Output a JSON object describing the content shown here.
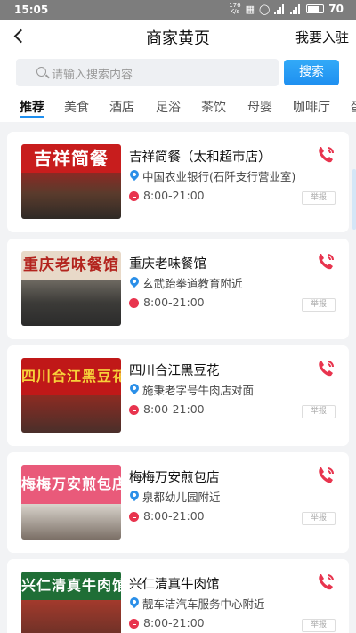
{
  "status_bar": {
    "time": "15:05",
    "network": "176\nK/s",
    "battery": "70"
  },
  "nav": {
    "title": "商家黄页",
    "right_action": "我要入驻"
  },
  "search": {
    "placeholder": "请输入搜索内容",
    "button": "搜索"
  },
  "tabs": [
    "推荐",
    "美食",
    "酒店",
    "足浴",
    "茶饮",
    "母婴",
    "咖啡厅",
    "蛋"
  ],
  "active_tab": "推荐",
  "accent_color": "#1e8ff0",
  "report_label": "举报",
  "merchants": [
    {
      "name": "吉祥简餐（太和超市店）",
      "address": "中国农业银行(石阡支行营业室)",
      "hours": "8:00-21:00",
      "sign_text": "吉祥简餐",
      "sign_bg": "#c81d1d",
      "sign_color": "#ffffff"
    },
    {
      "name": "重庆老味餐馆",
      "address": "玄武跆拳道教育附近",
      "hours": "8:00-21:00",
      "sign_text": "重庆老味餐馆",
      "sign_bg": "#e8d9c8",
      "sign_color": "#b3241e"
    },
    {
      "name": "四川合江黑豆花",
      "address": "施秉老字号牛肉店对面",
      "hours": "8:00-21:00",
      "sign_text": "四川合江黑豆花",
      "sign_bg": "#c01818",
      "sign_color": "#f7d13a"
    },
    {
      "name": "梅梅万安煎包店",
      "address": "泉都幼儿园附近",
      "hours": "8:00-21:00",
      "sign_text": "梅梅万安煎包店",
      "sign_bg": "#e95a7a",
      "sign_color": "#ffffff"
    },
    {
      "name": "兴仁清真牛肉馆",
      "address": "靓车洁汽车服务中心附近",
      "hours": "8:00-21:00",
      "sign_text": "兴仁清真牛肉馆",
      "sign_bg": "#1f6e36",
      "sign_color": "#ffffff"
    }
  ]
}
